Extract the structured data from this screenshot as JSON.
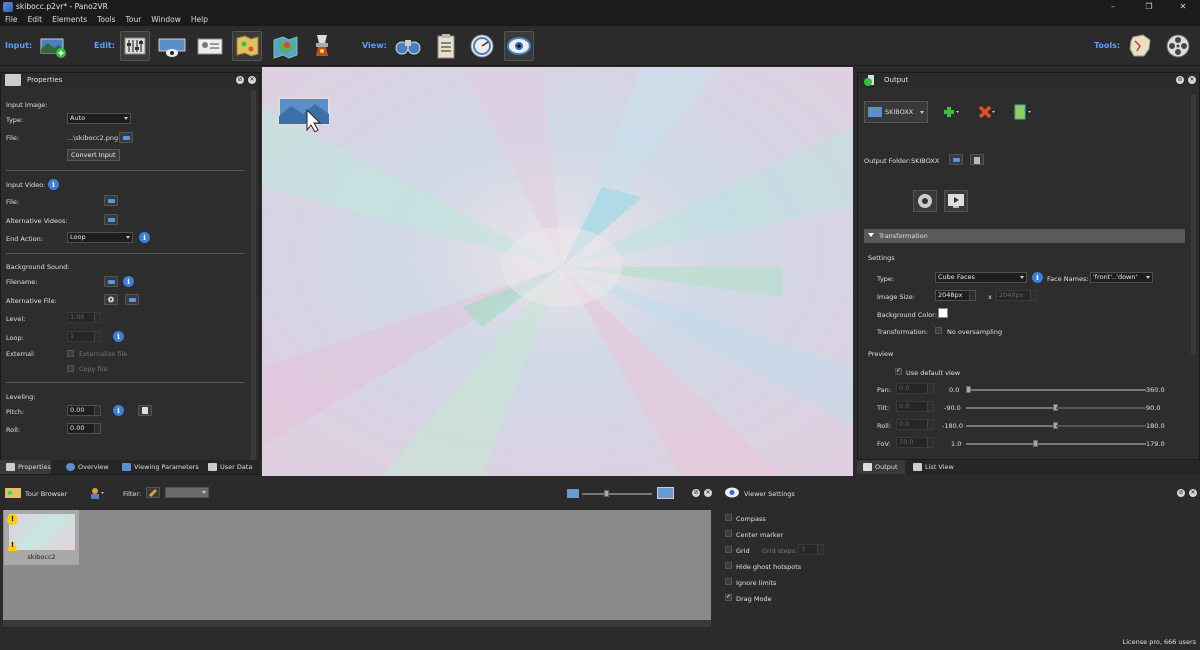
{
  "window": {
    "title": "skibocc.p2vr* - Pano2VR",
    "minimize": "–",
    "maximize": "❐",
    "close": "✕"
  },
  "menu": [
    "File",
    "Edit",
    "Elements",
    "Tools",
    "Tour",
    "Window",
    "Help"
  ],
  "toolbar": {
    "input_label": "Input:",
    "edit_label": "Edit:",
    "view_label": "View:",
    "tools_label": "Tools:"
  },
  "properties": {
    "title": "Properties",
    "input_image": {
      "heading": "Input Image:",
      "type_label": "Type:",
      "type_value": "Auto",
      "file_label": "File:",
      "file_value": "...\\skibocc2.png",
      "convert_label": "Convert Input"
    },
    "input_video": {
      "heading": "Input Video:",
      "file_label": "File:",
      "alt_label": "Alternative Videos:",
      "end_label": "End Action:",
      "end_value": "Loop"
    },
    "background_sound": {
      "heading": "Background Sound:",
      "filename_label": "Filename:",
      "altfile_label": "Alternative File:",
      "level_label": "Level:",
      "level_value": "1.00",
      "loop_label": "Loop:",
      "loop_value": "1",
      "external_label": "External:",
      "externalize_label": "Externalize file",
      "copy_label": "Copy file"
    },
    "leveling": {
      "heading": "Leveling:",
      "pitch_label": "Pitch:",
      "pitch_value": "0.00",
      "roll_label": "Roll:",
      "roll_value": "0.00"
    },
    "tabs": [
      "Properties",
      "Overview",
      "Viewing Parameters",
      "User Data"
    ]
  },
  "output": {
    "title": "Output",
    "format": "SKIBOXX",
    "folder_label": "Output Folder:",
    "folder_value": "SKIBOXX",
    "transformation_header": "Transformation",
    "settings_label": "Settings",
    "type_label": "Type:",
    "type_value": "Cube Faces",
    "face_names_label": "Face Names:",
    "face_names_value": "'front'..'down'",
    "image_size_label": "Image Size:",
    "image_size_value": "2048px",
    "image_size_x": "x",
    "image_size_value2": "2048px",
    "bg_color_label": "Background Color:",
    "transformation_label": "Transformation:",
    "no_oversampling_label": "No oversampling",
    "preview_label": "Preview",
    "use_default_view": "Use default view",
    "pan": {
      "label": "Pan:",
      "value": "0.0",
      "min": "0.0",
      "max": "360.0",
      "level": 0.0
    },
    "tilt": {
      "label": "Tilt:",
      "value": "0.0",
      "min": "-90.0",
      "max": "90.0",
      "level": 0.5
    },
    "roll": {
      "label": "Roll:",
      "value": "0.0",
      "min": "-180.0",
      "max": "180.0",
      "level": 0.5
    },
    "fov": {
      "label": "FoV:",
      "value": "70.0",
      "min": "1.0",
      "max": "179.0",
      "level": 0.39
    },
    "tabs": [
      "Output",
      "List View"
    ]
  },
  "tour_browser": {
    "title": "Tour Browser",
    "filter_label": "Filter:",
    "thumbnail_label": "skibocc2",
    "badge": "!"
  },
  "viewer_settings": {
    "title": "Viewer Settings",
    "compass": "Compass",
    "center_marker": "Center marker",
    "grid": "Grid",
    "grid_steps_label": "Grid steps:",
    "grid_steps_value": "3",
    "hide_ghost": "Hide ghost hotspots",
    "ignore_limits": "Ignore limits",
    "drag_mode": "Drag Mode"
  },
  "status": {
    "license": "License pro, 666 users"
  },
  "colors": {
    "accent": "#5aa0ff",
    "info": "#3d7fd8",
    "add": "#3cbf3c",
    "remove": "#e0502a"
  }
}
